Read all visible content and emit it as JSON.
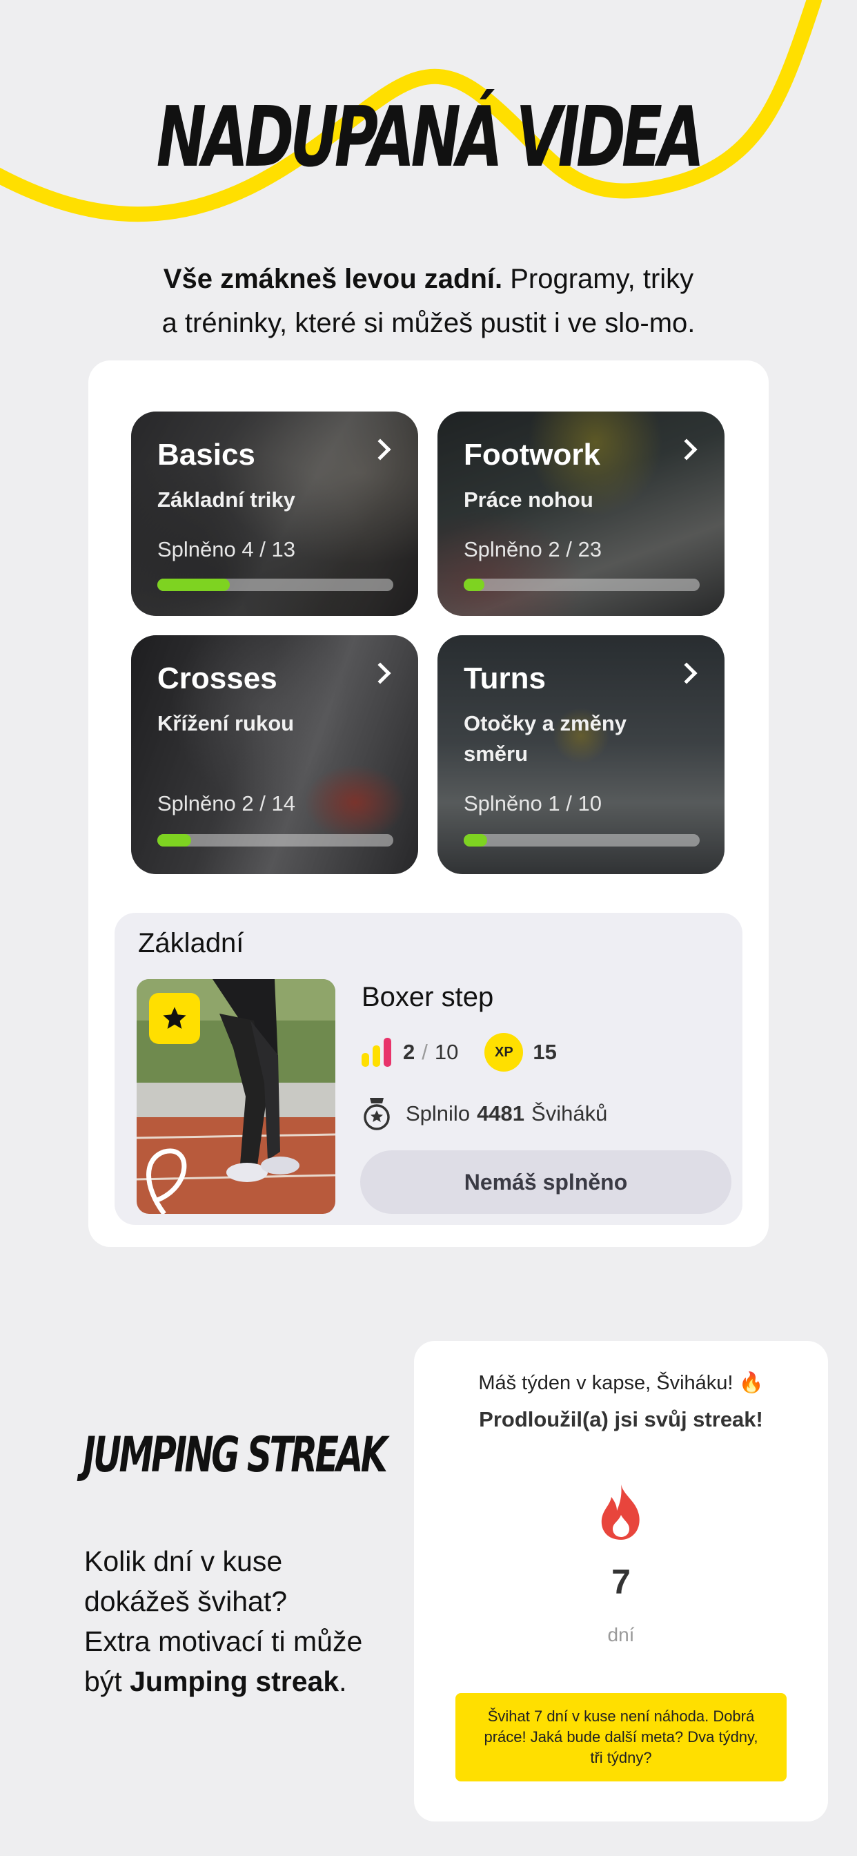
{
  "hero": {
    "title": "NADUPANÁ VIDEA",
    "intro_bold": "Vše zmákneš levou zadní.",
    "intro_rest": " Programy, triky",
    "intro_line2": "a tréninky, které si můžeš pustit i ve slo-mo."
  },
  "programs": [
    {
      "title": "Basics",
      "subtitle": "Základní triky",
      "progress_label": "Splněno 4 / 13",
      "done": 4,
      "total": 13
    },
    {
      "title": "Footwork",
      "subtitle": "Práce nohou",
      "progress_label": "Splněno 2 / 23",
      "done": 2,
      "total": 23
    },
    {
      "title": "Crosses",
      "subtitle": "Křížení rukou",
      "progress_label": "Splněno 2 / 14",
      "done": 2,
      "total": 14
    },
    {
      "title": "Turns",
      "subtitle": "Otočky a změny směru",
      "progress_label": "Splněno 1 / 10",
      "done": 1,
      "total": 10
    }
  ],
  "lesson": {
    "section": "Základní",
    "name": "Boxer step",
    "level": "2",
    "level_sep": "/",
    "level_max": "10",
    "xp_badge": "XP",
    "xp": "15",
    "completed_prefix": "Splnilo",
    "completed_count": "4481",
    "completed_suffix": "Šviháků",
    "cta": "Nemáš splněno",
    "accent_color": "#ffdf00",
    "level_bar_colors": [
      "#ffdf00",
      "#ffdf00",
      "#e8336a"
    ]
  },
  "streak": {
    "title": "JUMPING STREAK",
    "text_l1": "Kolik dní v kuse",
    "text_l2": "dokážeš švihat?",
    "text_l3": "Extra motivací ti může",
    "text_l4_prefix": "být ",
    "text_l4_bold": "Jumping streak",
    "text_l4_suffix": ".",
    "card_line1": "Máš týden v kapse, Šviháku! 🔥",
    "card_line2": "Prodloužil(a) jsi svůj streak!",
    "days": "7",
    "days_unit": "dní",
    "note": "Švihat 7 dní v kuse není náhoda. Dobrá práce! Jaká bude další meta? Dva týdny, tři týdny?",
    "flame_color": "#e8453c"
  },
  "colors": {
    "background": "#eeeef0",
    "accent_yellow": "#ffdf00",
    "progress_green": "#7ed321"
  }
}
